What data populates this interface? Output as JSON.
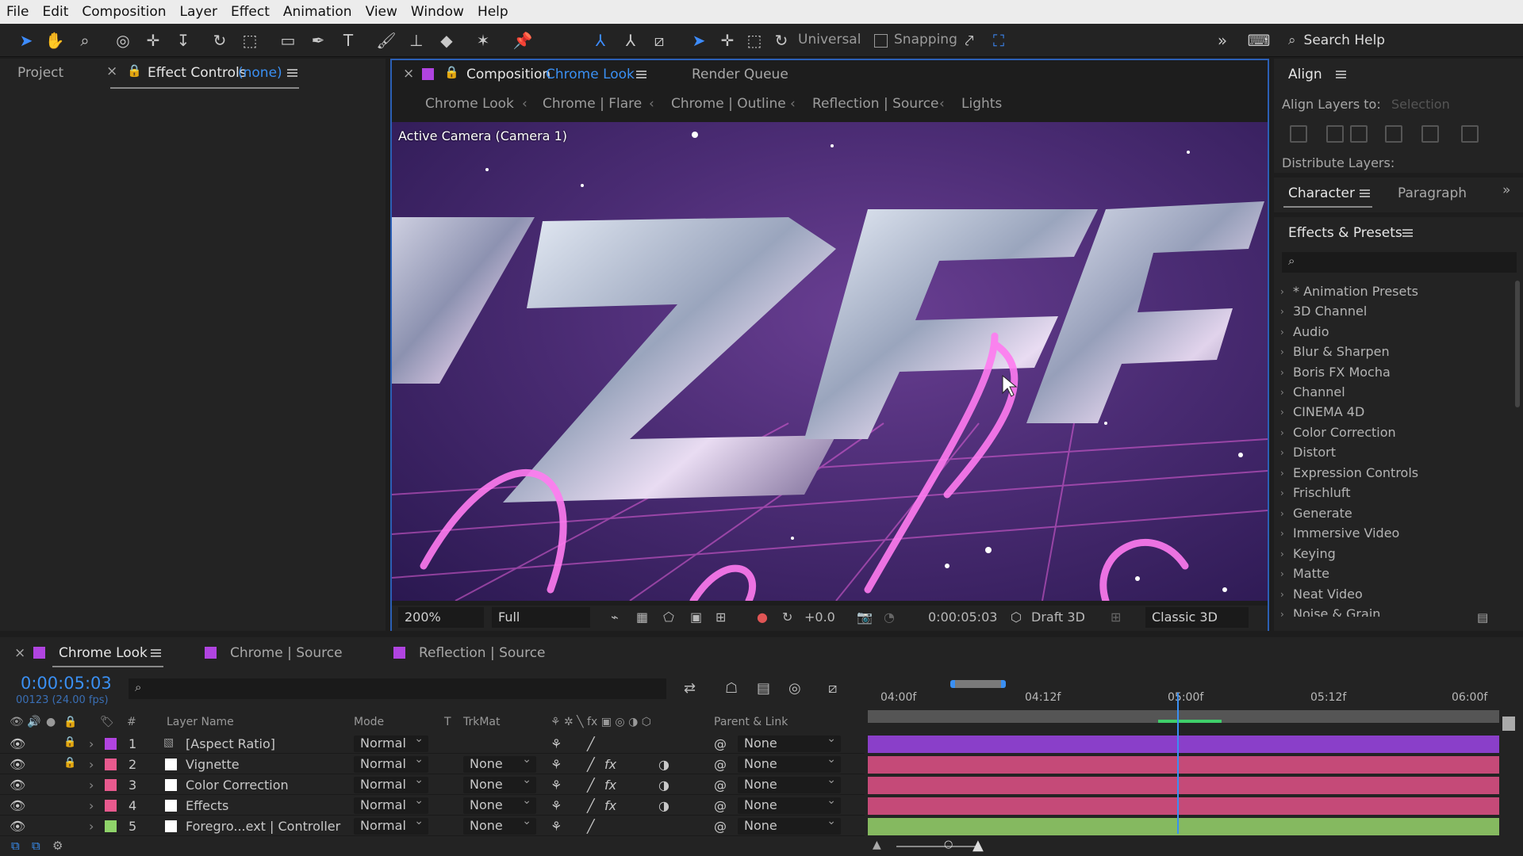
{
  "menu": [
    "File",
    "Edit",
    "Composition",
    "Layer",
    "Effect",
    "Animation",
    "View",
    "Window",
    "Help"
  ],
  "toolbar": {
    "universal_label": "Universal",
    "snapping_label": "Snapping",
    "search_placeholder": "Search Help"
  },
  "left_panel": {
    "project_tab": "Project",
    "effect_controls_tab": "Effect Controls",
    "effect_controls_target": "(none)"
  },
  "comp_panel": {
    "tab_prefix": "Composition",
    "tab_name": "Chrome Look",
    "render_queue_tab": "Render Queue",
    "breadcrumbs": [
      "Chrome Look",
      "Chrome | Flare",
      "Chrome | Outline",
      "Reflection | Source",
      "Lights"
    ],
    "viewer_label": "Active Camera (Camera 1)",
    "footer": {
      "zoom": "200%",
      "resolution": "Full",
      "exposure": "+0.0",
      "timecode": "0:00:05:03",
      "draft3d": "Draft 3D",
      "renderer": "Classic 3D"
    }
  },
  "align_panel": {
    "title": "Align",
    "align_layers_to": "Align Layers to:",
    "align_target": "Selection",
    "distribute_layers": "Distribute Layers:"
  },
  "char_panel": {
    "tab_character": "Character",
    "tab_paragraph": "Paragraph"
  },
  "effects_panel": {
    "title": "Effects & Presets",
    "items": [
      "* Animation Presets",
      "3D Channel",
      "Audio",
      "Blur & Sharpen",
      "Boris FX Mocha",
      "Channel",
      "CINEMA 4D",
      "Color Correction",
      "Distort",
      "Expression Controls",
      "Frischluft",
      "Generate",
      "Immersive Video",
      "Keying",
      "Matte",
      "Neat Video",
      "Noise & Grain"
    ]
  },
  "timeline": {
    "tabs": [
      "Chrome Look",
      "Chrome | Source",
      "Reflection | Source"
    ],
    "tab_colors": [
      "#b044e0",
      "#b044e0",
      "#b044e0"
    ],
    "timecode": "0:00:05:03",
    "fps": "00123 (24.00 fps)",
    "headers": {
      "num": "#",
      "layer_name": "Layer Name",
      "mode": "Mode",
      "t": "T",
      "trkmat": "TrkMat",
      "parent": "Parent & Link"
    },
    "ruler": [
      "04:00f",
      "04:12f",
      "05:00f",
      "05:12f",
      "06:00f"
    ],
    "current_time_fraction": 0.49,
    "layers": [
      {
        "num": "1",
        "name": "[Aspect Ratio]",
        "mode": "Normal",
        "trkmat": "",
        "parent": "None",
        "color": "#b044e0",
        "track": "#8a3fc9"
      },
      {
        "num": "2",
        "name": "Vignette",
        "mode": "Normal",
        "trkmat": "None",
        "parent": "None",
        "color": "#e85a8e",
        "track": "#c54a78"
      },
      {
        "num": "3",
        "name": "Color Correction",
        "mode": "Normal",
        "trkmat": "None",
        "parent": "None",
        "color": "#e85a8e",
        "track": "#c54a78"
      },
      {
        "num": "4",
        "name": "Effects",
        "mode": "Normal",
        "trkmat": "None",
        "parent": "None",
        "color": "#e85a8e",
        "track": "#c54a78"
      },
      {
        "num": "5",
        "name": "Foregro...ext | Controller",
        "mode": "Normal",
        "trkmat": "None",
        "parent": "None",
        "color": "#8fd36a",
        "track": "#85b960"
      }
    ]
  },
  "colors": {
    "accent_blue": "#3a8ff2",
    "panel_bg": "#232323",
    "menubar_bg": "#ececec"
  }
}
